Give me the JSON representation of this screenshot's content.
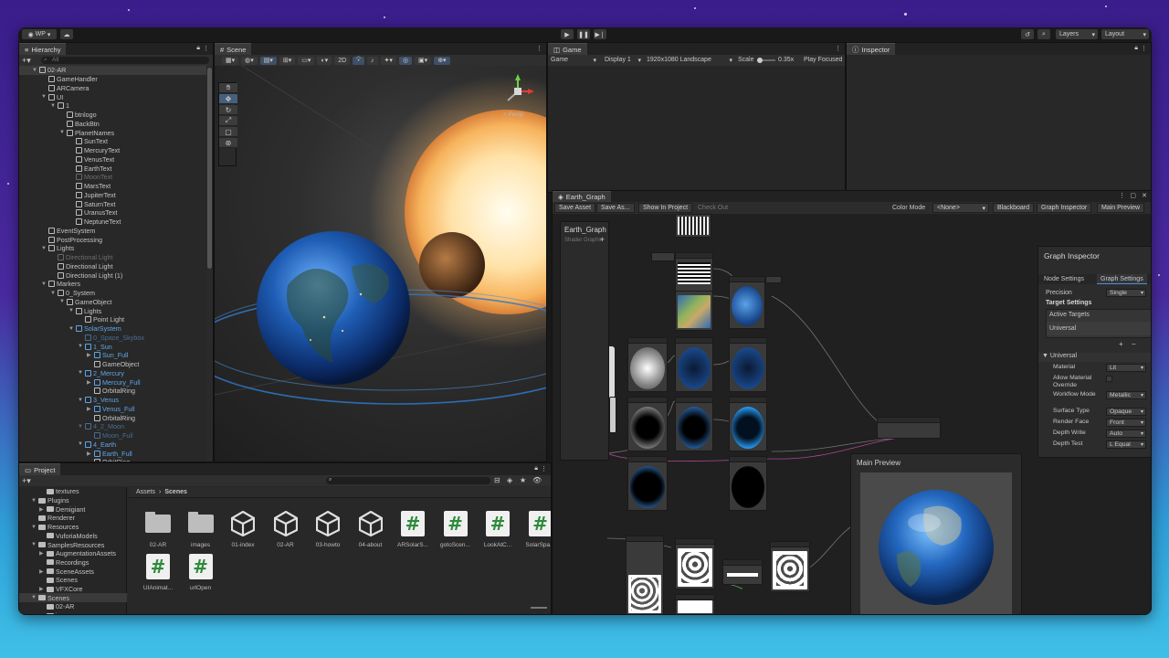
{
  "top_toolbar": {
    "account": "WP",
    "right_buttons": [
      "Layers",
      "Layout"
    ]
  },
  "hierarchy": {
    "tab": "Hierarchy",
    "search_placeholder": "All",
    "rows": [
      {
        "label": "02-AR",
        "indent": 0,
        "arrow": "▼",
        "style": "normal"
      },
      {
        "label": "GameHandler",
        "indent": 1,
        "arrow": "",
        "style": "normal"
      },
      {
        "label": "ARCamera",
        "indent": 1,
        "arrow": "",
        "style": "normal"
      },
      {
        "label": "UI",
        "indent": 1,
        "arrow": "▼",
        "style": "normal"
      },
      {
        "label": "1",
        "indent": 2,
        "arrow": "▼",
        "style": "normal"
      },
      {
        "label": "btnlogo",
        "indent": 3,
        "arrow": "",
        "style": "normal"
      },
      {
        "label": "BackBtn",
        "indent": 3,
        "arrow": "",
        "style": "normal"
      },
      {
        "label": "PlanetNames",
        "indent": 3,
        "arrow": "▼",
        "style": "normal"
      },
      {
        "label": "SunText",
        "indent": 4,
        "arrow": "",
        "style": "normal"
      },
      {
        "label": "MercuryText",
        "indent": 4,
        "arrow": "",
        "style": "normal"
      },
      {
        "label": "VenusText",
        "indent": 4,
        "arrow": "",
        "style": "normal"
      },
      {
        "label": "EarthText",
        "indent": 4,
        "arrow": "",
        "style": "normal"
      },
      {
        "label": "MoonText",
        "indent": 4,
        "arrow": "",
        "style": "dim"
      },
      {
        "label": "MarsText",
        "indent": 4,
        "arrow": "",
        "style": "normal"
      },
      {
        "label": "JupiterText",
        "indent": 4,
        "arrow": "",
        "style": "normal"
      },
      {
        "label": "SaturnText",
        "indent": 4,
        "arrow": "",
        "style": "normal"
      },
      {
        "label": "UranusText",
        "indent": 4,
        "arrow": "",
        "style": "normal"
      },
      {
        "label": "NeptuneText",
        "indent": 4,
        "arrow": "",
        "style": "normal"
      },
      {
        "label": "EventSystem",
        "indent": 1,
        "arrow": "",
        "style": "normal"
      },
      {
        "label": "PostProcessing",
        "indent": 1,
        "arrow": "",
        "style": "normal"
      },
      {
        "label": "Lights",
        "indent": 1,
        "arrow": "▼",
        "style": "normal"
      },
      {
        "label": "Directional Light",
        "indent": 2,
        "arrow": "",
        "style": "dim"
      },
      {
        "label": "Directional Light",
        "indent": 2,
        "arrow": "",
        "style": "normal"
      },
      {
        "label": "Directional Light (1)",
        "indent": 2,
        "arrow": "",
        "style": "normal"
      },
      {
        "label": "Markers",
        "indent": 1,
        "arrow": "▼",
        "style": "normal"
      },
      {
        "label": "0_System",
        "indent": 2,
        "arrow": "▼",
        "style": "normal"
      },
      {
        "label": "GameObject",
        "indent": 3,
        "arrow": "▼",
        "style": "normal"
      },
      {
        "label": "Lights",
        "indent": 4,
        "arrow": "▼",
        "style": "normal"
      },
      {
        "label": "Point Light",
        "indent": 5,
        "arrow": "",
        "style": "normal"
      },
      {
        "label": "SolarSystem",
        "indent": 4,
        "arrow": "▼",
        "style": "blue"
      },
      {
        "label": "0_Space_Skybox",
        "indent": 5,
        "arrow": "",
        "style": "dim-blue"
      },
      {
        "label": "1_Sun",
        "indent": 5,
        "arrow": "▼",
        "style": "blue"
      },
      {
        "label": "Sun_Full",
        "indent": 6,
        "arrow": "▶",
        "style": "blue"
      },
      {
        "label": "GameObject",
        "indent": 6,
        "arrow": "",
        "style": "normal"
      },
      {
        "label": "2_Mercury",
        "indent": 5,
        "arrow": "▼",
        "style": "blue"
      },
      {
        "label": "Mercury_Full",
        "indent": 6,
        "arrow": "▶",
        "style": "blue"
      },
      {
        "label": "OrbitalRing",
        "indent": 6,
        "arrow": "",
        "style": "normal"
      },
      {
        "label": "3_Venus",
        "indent": 5,
        "arrow": "▼",
        "style": "blue"
      },
      {
        "label": "Venus_Full",
        "indent": 6,
        "arrow": "▶",
        "style": "blue"
      },
      {
        "label": "OrbitalRing",
        "indent": 6,
        "arrow": "",
        "style": "normal"
      },
      {
        "label": "4_2_Moon",
        "indent": 5,
        "arrow": "▼",
        "style": "dim-blue"
      },
      {
        "label": "Moon_Full",
        "indent": 6,
        "arrow": "",
        "style": "dim-blue"
      },
      {
        "label": "4_Earth",
        "indent": 5,
        "arrow": "▼",
        "style": "blue"
      },
      {
        "label": "Earth_Full",
        "indent": 6,
        "arrow": "▶",
        "style": "blue"
      },
      {
        "label": "OrbitRing",
        "indent": 6,
        "arrow": "",
        "style": "normal"
      }
    ]
  },
  "scene": {
    "tab": "Scene",
    "toggle_2d": "2D",
    "persp_label": "< Persp"
  },
  "game": {
    "tab": "Game",
    "mode": "Game",
    "display": "Display 1",
    "resolution": "1920x1080 Landscape",
    "scale_label": "Scale",
    "scale_value": "0.35x",
    "play_focused": "Play Focused"
  },
  "inspector": {
    "tab": "Inspector"
  },
  "shader_graph": {
    "tab": "Earth_Graph",
    "buttons": [
      "Save Asset",
      "Save As...",
      "Show In Project",
      "Check Out"
    ],
    "color_mode_label": "Color Mode",
    "color_mode_value": "<None>",
    "right_buttons": [
      "Blackboard",
      "Graph Inspector",
      "Main Preview"
    ],
    "blackboard_title": "Earth_Graph",
    "blackboard_subtitle": "Shader Graphs",
    "main_preview_title": "Main Preview"
  },
  "graph_inspector": {
    "title": "Graph Inspector",
    "tabs": [
      "Node Settings",
      "Graph Settings"
    ],
    "precision_label": "Precision",
    "precision_value": "Single",
    "target_settings": "Target Settings",
    "active_targets": "Active Targets",
    "active_target_item": "Universal",
    "universal_section": "Universal",
    "fields": [
      {
        "label": "Material",
        "value": "Lit"
      },
      {
        "label": "Allow Material Override",
        "value": ""
      },
      {
        "label": "Workflow Mode",
        "value": "Metallic"
      },
      {
        "label": "Surface Type",
        "value": "Opaque"
      },
      {
        "label": "Render Face",
        "value": "Front"
      },
      {
        "label": "Depth Write",
        "value": "Auto"
      },
      {
        "label": "Depth Test",
        "value": "L Equal"
      }
    ]
  },
  "project": {
    "tab": "Project",
    "tree": [
      {
        "label": "textures",
        "indent": 2,
        "arrow": ""
      },
      {
        "label": "Plugins",
        "indent": 1,
        "arrow": "▼"
      },
      {
        "label": "Demigiant",
        "indent": 2,
        "arrow": "▶"
      },
      {
        "label": "Renderer",
        "indent": 1,
        "arrow": ""
      },
      {
        "label": "Resources",
        "indent": 1,
        "arrow": "▼"
      },
      {
        "label": "VuforiaModels",
        "indent": 2,
        "arrow": ""
      },
      {
        "label": "SamplesResources",
        "indent": 1,
        "arrow": "▼"
      },
      {
        "label": "AugmentationAssets",
        "indent": 2,
        "arrow": "▶"
      },
      {
        "label": "Recordings",
        "indent": 2,
        "arrow": ""
      },
      {
        "label": "SceneAssets",
        "indent": 2,
        "arrow": "▶"
      },
      {
        "label": "Scenes",
        "indent": 2,
        "arrow": ""
      },
      {
        "label": "VFXCore",
        "indent": 2,
        "arrow": "▶"
      },
      {
        "label": "Scenes",
        "indent": 1,
        "arrow": "▼"
      },
      {
        "label": "02-AR",
        "indent": 2,
        "arrow": ""
      },
      {
        "label": "images",
        "indent": 2,
        "arrow": ""
      }
    ],
    "breadcrumb": [
      "Assets",
      "Scenes"
    ],
    "assets": [
      {
        "label": "02-AR",
        "kind": "folder"
      },
      {
        "label": "images",
        "kind": "folder"
      },
      {
        "label": "01-index",
        "kind": "unity"
      },
      {
        "label": "02-AR",
        "kind": "unity"
      },
      {
        "label": "03-howto",
        "kind": "unity"
      },
      {
        "label": "04-about",
        "kind": "unity"
      },
      {
        "label": "ARSolarS...",
        "kind": "script"
      },
      {
        "label": "gotoScen...",
        "kind": "script"
      },
      {
        "label": "LookAtC...",
        "kind": "script"
      },
      {
        "label": "SolarSpa...",
        "kind": "script"
      },
      {
        "label": "UIAnimat...",
        "kind": "script"
      },
      {
        "label": "urlOpen",
        "kind": "script"
      }
    ]
  }
}
